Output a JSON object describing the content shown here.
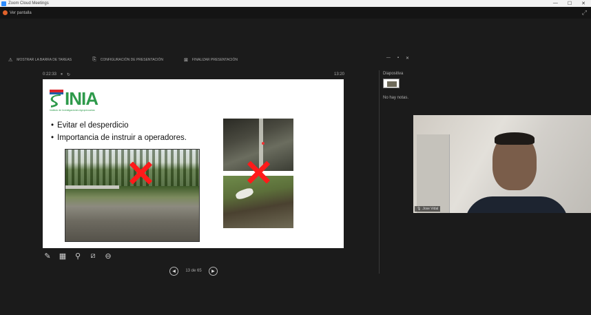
{
  "window": {
    "title": "Zoom Cloud Meetings",
    "controls": [
      "—",
      "☐",
      "✕"
    ]
  },
  "share_bar": {
    "label": "Ver pantalla"
  },
  "toolbar": {
    "items": [
      {
        "icon": "warning-icon",
        "label": "MOSTRAR LA BARRA DE TAREAS"
      },
      {
        "icon": "display-icon",
        "label": "CONFIGURACIÓN DE PRESENTACIÓN"
      },
      {
        "icon": "stop-icon",
        "label": "FINALIZAR PRESENTACIÓN"
      }
    ],
    "window_controls": [
      "—",
      "▪",
      "✕"
    ]
  },
  "timer": {
    "elapsed": "0:22:33",
    "clock": "13:20"
  },
  "slide": {
    "logo_text": "INIA",
    "logo_tagline": "Instituto de Investigaciones Agropecuarias",
    "bullets": [
      "Evitar el desperdicio",
      "Importancia de instruir a operadores."
    ]
  },
  "slide_nav": {
    "counter": "13 de 65"
  },
  "next_panel": {
    "title": "Diapositiva",
    "note": "No hay notas."
  },
  "video": {
    "name": "Jose Vidal"
  },
  "colors": {
    "inia_green": "#2e9a4b",
    "cross_red": "#ff1a1a"
  }
}
